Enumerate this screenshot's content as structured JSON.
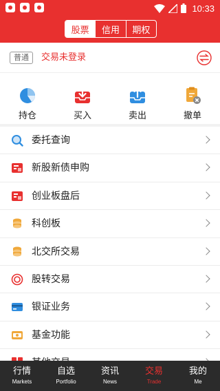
{
  "status_bar": {
    "time": "10:33",
    "app_icons": [
      "notification-icon",
      "notification-icon",
      "notification-icon"
    ],
    "right_icons": [
      "wifi-icon",
      "signal-icon",
      "battery-icon"
    ]
  },
  "header": {
    "tabs": [
      {
        "label": "股票",
        "active": true
      },
      {
        "label": "信用",
        "active": false
      },
      {
        "label": "期权",
        "active": false
      }
    ]
  },
  "login_bar": {
    "badge": "普通",
    "text": "交易未登录",
    "switch_icon": "exchange-icon"
  },
  "actions": [
    {
      "label": "持仓",
      "icon": "pie-chart-icon"
    },
    {
      "label": "买入",
      "icon": "tray-in-icon"
    },
    {
      "label": "卖出",
      "icon": "tray-out-icon"
    },
    {
      "label": "撤单",
      "icon": "cancel-order-icon"
    }
  ],
  "menu": [
    {
      "label": "委托查询",
      "icon": "search-icon"
    },
    {
      "label": "新股新债申购",
      "icon": "ipo-icon"
    },
    {
      "label": "创业板盘后",
      "icon": "board-icon"
    },
    {
      "label": "科创板",
      "icon": "coins-icon"
    },
    {
      "label": "北交所交易",
      "icon": "coins-icon"
    },
    {
      "label": "股转交易",
      "icon": "ring-icon"
    },
    {
      "label": "银证业务",
      "icon": "card-icon"
    },
    {
      "label": "基金功能",
      "icon": "wallet-icon"
    },
    {
      "label": "其他交易",
      "icon": "grid-icon"
    }
  ],
  "tabbar": [
    {
      "label": "行情",
      "sub": "Markets",
      "active": false
    },
    {
      "label": "自选",
      "sub": "Portfolio",
      "active": false
    },
    {
      "label": "资讯",
      "sub": "News",
      "active": false
    },
    {
      "label": "交易",
      "sub": "Trade",
      "active": true
    },
    {
      "label": "我的",
      "sub": "Me",
      "active": false
    }
  ],
  "colors": {
    "brand_red": "#e8302f",
    "tabbar_bg": "#2b2b2b",
    "icon_blue": "#2f8ee0",
    "icon_orange": "#f0a83a"
  }
}
